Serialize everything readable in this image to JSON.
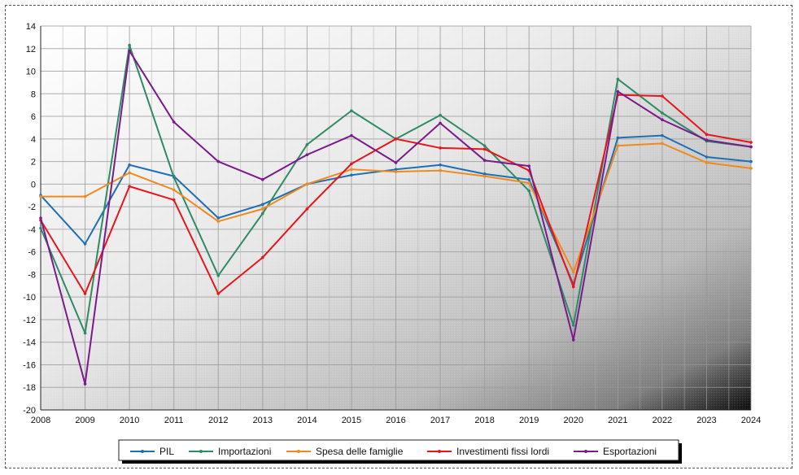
{
  "chart_data": {
    "type": "line",
    "title": "",
    "xlabel": "",
    "ylabel": "",
    "categories": [
      "2008",
      "2009",
      "2010",
      "2011",
      "2012",
      "2013",
      "2014",
      "2015",
      "2016",
      "2017",
      "2018",
      "2019",
      "2020",
      "2021",
      "2022",
      "2023",
      "2024"
    ],
    "ylim": [
      -20,
      14
    ],
    "y_ticks": [
      14,
      12,
      10,
      8,
      6,
      4,
      2,
      0,
      -2,
      -4,
      -6,
      -8,
      -10,
      -12,
      -14,
      -16,
      -18,
      -20
    ],
    "grid": true,
    "legend_position": "bottom",
    "series": [
      {
        "name": "PIL",
        "color": "#1f6fb5",
        "values": [
          -1.0,
          -5.3,
          1.7,
          0.7,
          -3.0,
          -1.8,
          0.0,
          0.8,
          1.3,
          1.7,
          0.9,
          0.4,
          -8.9,
          4.1,
          4.3,
          2.4,
          2.0
        ]
      },
      {
        "name": "Importazioni",
        "color": "#2e8b63",
        "values": [
          -3.9,
          -13.2,
          12.3,
          0.6,
          -8.1,
          -2.6,
          3.5,
          6.5,
          4.0,
          6.1,
          3.4,
          -0.6,
          -12.5,
          9.3,
          6.3,
          3.8,
          3.3
        ]
      },
      {
        "name": "Spesa delle famiglie",
        "color": "#f08a1c",
        "values": [
          -1.1,
          -1.1,
          1.0,
          -0.5,
          -3.3,
          -2.2,
          0.0,
          1.3,
          1.1,
          1.2,
          0.7,
          0.1,
          -7.8,
          3.4,
          3.6,
          1.9,
          1.4
        ]
      },
      {
        "name": "Investimenti fissi lordi",
        "color": "#e8161b",
        "values": [
          -3.2,
          -9.7,
          -0.2,
          -1.4,
          -9.7,
          -6.5,
          -2.2,
          1.8,
          4.0,
          3.2,
          3.1,
          1.2,
          -9.1,
          7.9,
          7.8,
          4.4,
          3.7
        ]
      },
      {
        "name": "Esportazioni",
        "color": "#7b1a8c",
        "values": [
          -3.0,
          -17.7,
          11.8,
          5.5,
          2.0,
          0.4,
          2.6,
          4.3,
          1.9,
          5.4,
          2.1,
          1.6,
          -13.8,
          8.2,
          5.7,
          3.9,
          3.3
        ]
      }
    ]
  }
}
